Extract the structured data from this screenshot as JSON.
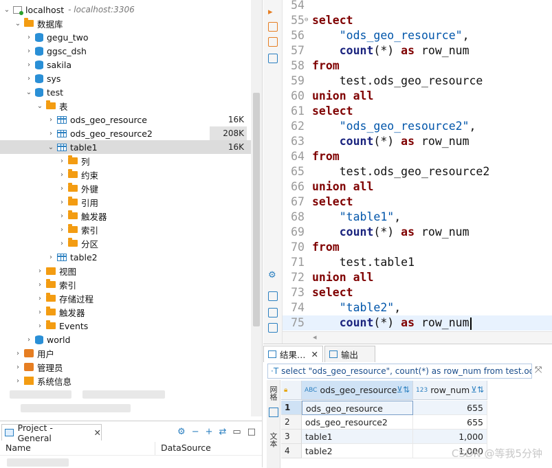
{
  "navigator": {
    "connection": {
      "name": "localhost",
      "host": "- localhost:3306"
    },
    "databases_label": "数据库",
    "databases": [
      "gegu_two",
      "ggsc_dsh",
      "sakila",
      "sys",
      "test"
    ],
    "tables_label": "表",
    "tables": [
      {
        "name": "ods_geo_resource",
        "size": "16K"
      },
      {
        "name": "ods_geo_resource2",
        "size": "208K"
      },
      {
        "name": "table1",
        "size": "16K"
      },
      {
        "name": "table2",
        "size": ""
      }
    ],
    "table1_children": [
      "列",
      "约束",
      "外键",
      "引用",
      "触发器",
      "索引",
      "分区"
    ],
    "test_children": [
      "视图",
      "索引",
      "存储过程",
      "触发器",
      "Events"
    ],
    "world": "world",
    "top_level": [
      "用户",
      "管理员",
      "系统信息"
    ]
  },
  "project": {
    "tab_label": "Project - General",
    "col_name": "Name",
    "col_datasource": "DataSource"
  },
  "editor": {
    "lines": [
      {
        "n": "54",
        "c": ""
      },
      {
        "n": "55",
        "c": "select"
      },
      {
        "n": "56",
        "c": "    \"ods_geo_resource\","
      },
      {
        "n": "57",
        "c": "    count(*) as row_num"
      },
      {
        "n": "58",
        "c": "from"
      },
      {
        "n": "59",
        "c": "    test.ods_geo_resource"
      },
      {
        "n": "60",
        "c": "union all"
      },
      {
        "n": "61",
        "c": "select"
      },
      {
        "n": "62",
        "c": "    \"ods_geo_resource2\","
      },
      {
        "n": "63",
        "c": "    count(*) as row_num"
      },
      {
        "n": "64",
        "c": "from"
      },
      {
        "n": "65",
        "c": "    test.ods_geo_resource2"
      },
      {
        "n": "66",
        "c": "union all"
      },
      {
        "n": "67",
        "c": "select"
      },
      {
        "n": "68",
        "c": "    \"table1\","
      },
      {
        "n": "69",
        "c": "    count(*) as row_num"
      },
      {
        "n": "70",
        "c": "from"
      },
      {
        "n": "71",
        "c": "    test.table1"
      },
      {
        "n": "72",
        "c": "union all"
      },
      {
        "n": "73",
        "c": "select"
      },
      {
        "n": "74",
        "c": "    \"table2\","
      },
      {
        "n": "75",
        "c": "    count(*) as row_num"
      }
    ]
  },
  "results": {
    "tab_results": "结果…",
    "tab_output": "输出",
    "query": "select \"ods_geo_resource\", count(*) as row_num from test.od",
    "side_grid": "网格",
    "side_text": "文本",
    "columns": [
      {
        "type": "ABC",
        "name": "ods_geo_resource"
      },
      {
        "type": "123",
        "name": "row_num"
      }
    ],
    "rows": [
      {
        "n": "1",
        "name": "ods_geo_resource",
        "val": "655"
      },
      {
        "n": "2",
        "name": "ods_geo_resource2",
        "val": "655"
      },
      {
        "n": "3",
        "name": "table1",
        "val": "1,000"
      },
      {
        "n": "4",
        "name": "table2",
        "val": "1,000"
      }
    ]
  },
  "watermark": "CSDN @等我5分钟"
}
